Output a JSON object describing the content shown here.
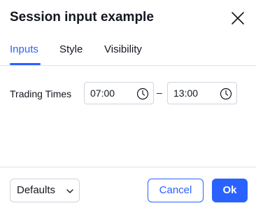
{
  "dialog": {
    "title": "Session input example",
    "close_icon": "close-icon"
  },
  "tabs": [
    {
      "label": "Inputs",
      "active": true
    },
    {
      "label": "Style",
      "active": false
    },
    {
      "label": "Visibility",
      "active": false
    }
  ],
  "inputs": {
    "trading_times": {
      "label": "Trading Times",
      "start": "07:00",
      "end": "13:00",
      "separator": "–",
      "icon": "clock-icon"
    }
  },
  "footer": {
    "defaults_label": "Defaults",
    "defaults_icon": "chevron-down-icon",
    "cancel_label": "Cancel",
    "ok_label": "Ok"
  },
  "colors": {
    "accent": "#2962ff",
    "text": "#131722",
    "border": "#d1d4dc",
    "divider": "#e0e3eb"
  }
}
